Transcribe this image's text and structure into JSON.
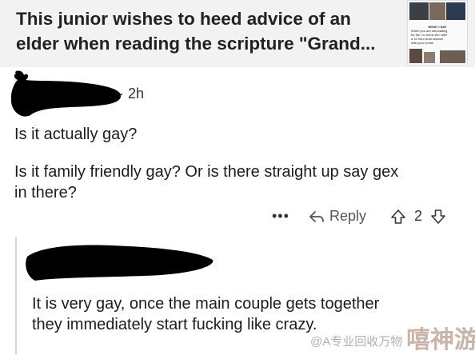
{
  "post": {
    "title_line1": "This junior wishes to heed advice of an",
    "title_line2": "elder when reading the scripture \"Grand...",
    "thumbnail": {
      "caption_header": "WHAT I SAY",
      "caption_lines": [
        "When you are still waiting",
        "for the 'no homo tho' after",
        "a 10 hour anal session",
        "with your homie"
      ]
    }
  },
  "comment": {
    "author": "",
    "time": "2h",
    "text_line1": "Is it actually gay?",
    "text_line2": "Is it family friendly gay? Or is there straight up say gex",
    "text_line3": "in there?",
    "more_label": "•••",
    "reply_label": "Reply",
    "score": "2"
  },
  "reply": {
    "text_line1": "It is very gay, once the main couple gets together",
    "text_line2": "they immediately start fucking like crazy."
  },
  "watermark": {
    "text": "@A专业回收万物",
    "logo": "嘻神游"
  },
  "colors": {
    "header_bg": "#f2f2f2",
    "thread_line": "#d6d6d6",
    "redaction": "#000000"
  }
}
